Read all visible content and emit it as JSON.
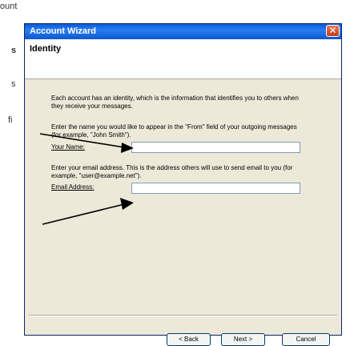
{
  "background": {
    "title": "ount",
    "frag1": "s",
    "frag2": "s",
    "frag3": "fi"
  },
  "dialog": {
    "title": "Account Wizard",
    "close_glyph": "✕",
    "header": "Identity",
    "intro": "Each account has an identity, which is the information that identifies you to others when they receive your messages.",
    "name_instructions": "Enter the name you would like to appear in the \"From\" field of your outgoing messages (for example, \"John Smith\").",
    "name_label": "Your Name:",
    "name_value": "",
    "email_instructions": "Enter your email address. This is the address others will use to send email to you (for example, \"user@example.net\").",
    "email_label": "Email Address:",
    "email_value": "",
    "buttons": {
      "back": "< Back",
      "next": "Next >",
      "cancel": "Cancel"
    }
  },
  "colors": {
    "titlebar": "#0a5cd8",
    "dialog_bg": "#ece9d8",
    "arrow": "#000000"
  }
}
